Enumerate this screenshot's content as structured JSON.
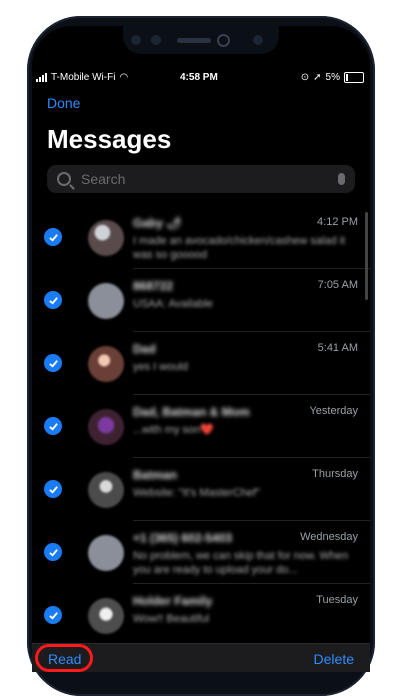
{
  "status": {
    "carrier": "T-Mobile Wi-Fi",
    "time": "4:58 PM",
    "battery": "5%"
  },
  "nav": {
    "done_label": "Done"
  },
  "page": {
    "title": "Messages"
  },
  "search": {
    "placeholder": "Search"
  },
  "threads": [
    {
      "name": "Gaby 🌶",
      "time": "4:12 PM",
      "preview": "I made an avocado/chicken/cashew salad it was so gooood",
      "avatar": "photo"
    },
    {
      "name": "868722",
      "time": "7:05 AM",
      "preview": "USAA: Available",
      "avatar": "default"
    },
    {
      "name": "Dad",
      "time": "5:41 AM",
      "preview": "yes I would",
      "avatar": "photo2"
    },
    {
      "name": "Dad, Batman & Mom",
      "time": "Yesterday",
      "preview": "...with my son❤️",
      "avatar": "photo3"
    },
    {
      "name": "Batman",
      "time": "Thursday",
      "preview": "Website: \"It's MasterChef\"",
      "avatar": "photo4"
    },
    {
      "name": "+1 (365) 602-5403",
      "time": "Wednesday",
      "preview": "No problem, we can skip that for now. When you are ready to upload your do...",
      "avatar": "default"
    },
    {
      "name": "Holder Family",
      "time": "Tuesday",
      "preview": "Wow!! Beautiful",
      "avatar": "photo5"
    }
  ],
  "toolbar": {
    "read_label": "Read",
    "delete_label": "Delete"
  },
  "colors": {
    "accent": "#2d8cff",
    "check": "#1a7cf5",
    "annotation": "#ff1a1a"
  }
}
